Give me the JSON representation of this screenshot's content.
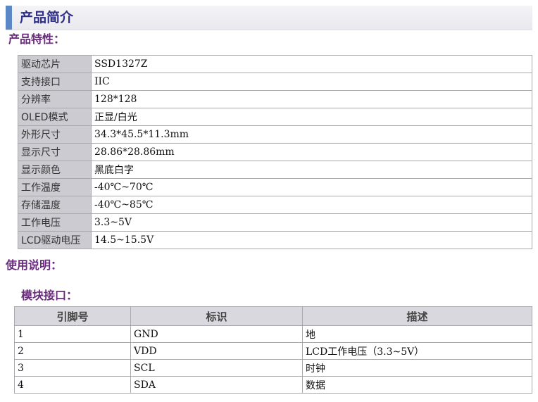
{
  "header": {
    "title": "产品简介"
  },
  "sections": {
    "features": "产品特性：",
    "usage": "使用说明：",
    "interface": "模块接口："
  },
  "specs": [
    {
      "key": "驱动芯片",
      "value": "SSD1327Z"
    },
    {
      "key": "支持接口",
      "value": "IIC"
    },
    {
      "key": "分辨率",
      "value": "128*128"
    },
    {
      "key": "OLED模式",
      "value": "正显/白光"
    },
    {
      "key": "外形尺寸",
      "value": "34.3*45.5*11.3mm"
    },
    {
      "key": "显示尺寸",
      "value": "28.86*28.86mm"
    },
    {
      "key": "显示颜色",
      "value": "黑底白字"
    },
    {
      "key": "工作温度",
      "value": "-40℃~70℃"
    },
    {
      "key": "存储温度",
      "value": "-40℃~85℃"
    },
    {
      "key": "工作电压",
      "value": "3.3~5V"
    },
    {
      "key": "LCD驱动电压",
      "value": "14.5~15.5V"
    }
  ],
  "pin_table": {
    "headers": [
      "引脚号",
      "标识",
      "描述"
    ],
    "rows": [
      [
        "1",
        "GND",
        "地"
      ],
      [
        "2",
        "VDD",
        "LCD工作电压（3.3~5V）"
      ],
      [
        "3",
        "SCL",
        "时钟"
      ],
      [
        "4",
        "SDA",
        "数据"
      ]
    ]
  },
  "colors": {
    "accent": "#5b87c6",
    "title": "#2e2e86",
    "section": "#6a2a7e",
    "key_cell": "#cbcbd1"
  }
}
